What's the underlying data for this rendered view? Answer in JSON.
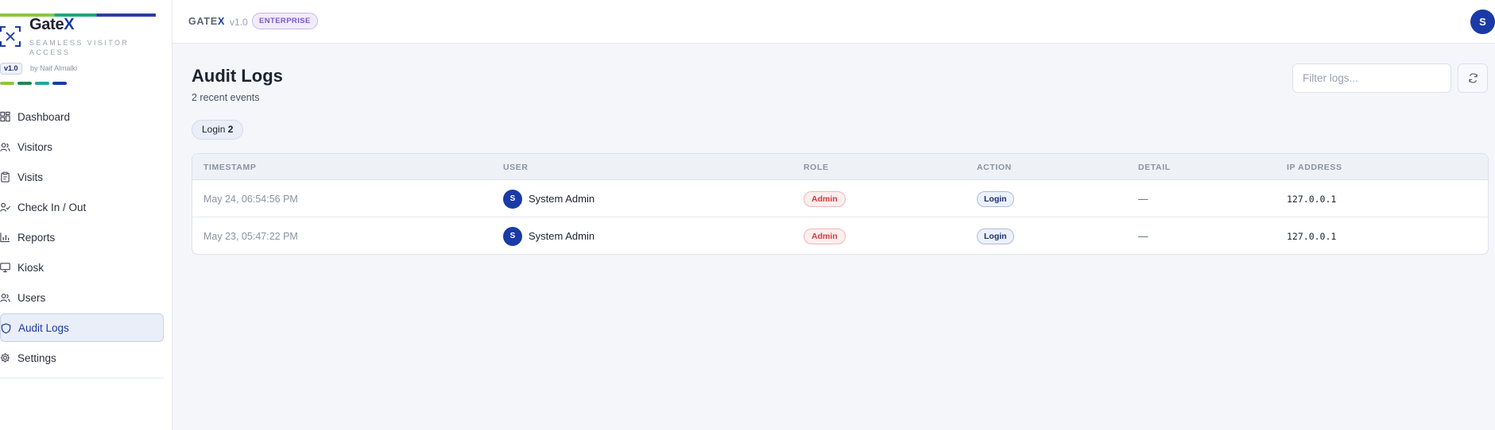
{
  "sidebar": {
    "brand_name_prefix": "Gate",
    "brand_name_suffix": "X",
    "tagline": "SEAMLESS VISITOR ACCESS",
    "version": "v1.0",
    "byline": "by Naif Almalki",
    "dash_colors": [
      "#8cc63f",
      "#1f8a4c",
      "#1fa8a0",
      "#1a3aa8"
    ],
    "items": [
      {
        "label": "Dashboard",
        "icon": "dashboard-icon"
      },
      {
        "label": "Visitors",
        "icon": "users-icon"
      },
      {
        "label": "Visits",
        "icon": "clipboard-icon"
      },
      {
        "label": "Check In / Out",
        "icon": "user-check-icon"
      },
      {
        "label": "Reports",
        "icon": "bar-chart-icon"
      },
      {
        "label": "Kiosk",
        "icon": "monitor-icon"
      },
      {
        "label": "Users",
        "icon": "users-icon"
      },
      {
        "label": "Audit Logs",
        "icon": "shield-icon",
        "active": true
      },
      {
        "label": "Settings",
        "icon": "gear-icon"
      }
    ]
  },
  "topbar": {
    "brand_prefix": "GATE",
    "brand_suffix": "X",
    "version": "v1.0",
    "badge": "ENTERPRISE",
    "avatar_initial": "S"
  },
  "main": {
    "title": "Audit Logs",
    "subtitle": "2 recent events",
    "filter_placeholder": "Filter logs...",
    "filter_value": "",
    "chip": {
      "label": "Login",
      "count": "2"
    },
    "columns": [
      "TIMESTAMP",
      "USER",
      "ROLE",
      "ACTION",
      "DETAIL",
      "IP ADDRESS"
    ],
    "rows": [
      {
        "timestamp": "May 24, 06:54:56 PM",
        "user_initial": "S",
        "user": "System Admin",
        "role": "Admin",
        "action": "Login",
        "detail": "—",
        "ip": "127.0.0.1"
      },
      {
        "timestamp": "May 23, 05:47:22 PM",
        "user_initial": "S",
        "user": "System Admin",
        "role": "Admin",
        "action": "Login",
        "detail": "—",
        "ip": "127.0.0.1"
      }
    ]
  },
  "colors": {
    "accent": "#1a3aa8",
    "role_admin": "#d33b3b",
    "enterprise_badge": "#7c56c9"
  }
}
